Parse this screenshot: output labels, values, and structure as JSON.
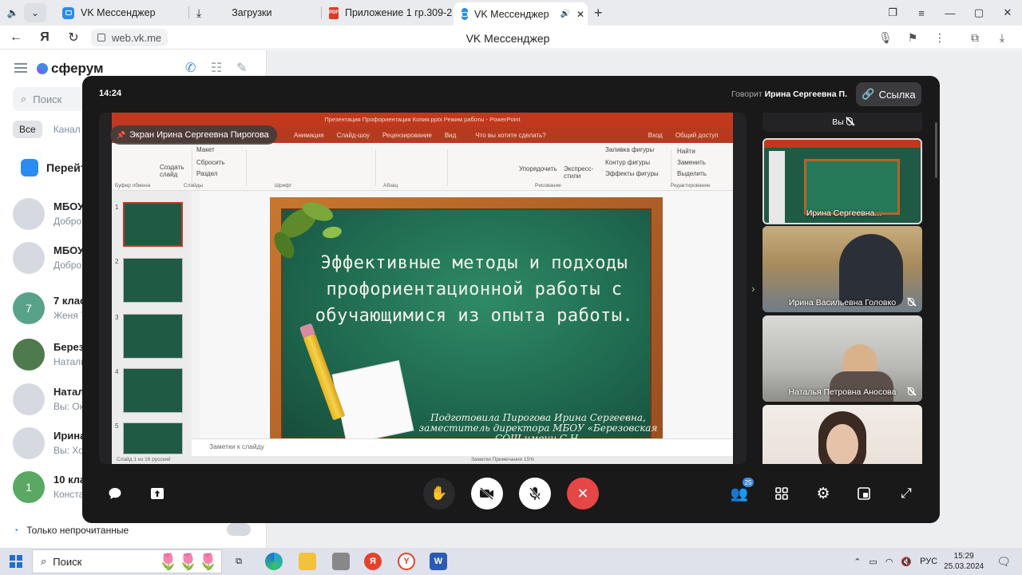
{
  "browser": {
    "tabs": [
      {
        "label": "VK Мессенджер",
        "icon": "vk-icon",
        "active": false
      },
      {
        "label": "Загрузки",
        "icon": "download-icon",
        "active": false
      },
      {
        "label": "Приложение 1 гр.309-24",
        "icon": "pdf-icon",
        "active": false
      },
      {
        "label": "VK Мессенджер",
        "icon": "vk-icon",
        "active": true
      }
    ],
    "url": "web.vk.me",
    "page_title": "VK Мессенджер"
  },
  "vk": {
    "logo": "сферум",
    "search_placeholder": "Поиск",
    "filters": [
      "Все",
      "Канал"
    ],
    "goto_label": "Перейт",
    "chats": [
      {
        "name": "МБОУ",
        "sub": "Добро",
        "badge": ""
      },
      {
        "name": "МБОУ",
        "sub": "Добро",
        "badge": ""
      },
      {
        "name": "7 клас",
        "sub": "Женя Т",
        "badge": "7"
      },
      {
        "name": "Березо",
        "sub": "Наталь",
        "badge": ""
      },
      {
        "name": "Натал",
        "sub": "Вы: Ок",
        "badge": ""
      },
      {
        "name": "Ирина",
        "sub": "Вы: Хо",
        "badge": ""
      },
      {
        "name": "10 кла",
        "sub": "Конста",
        "badge": "1"
      }
    ],
    "unread_only": "Только непрочитанные"
  },
  "call": {
    "time": "14:24",
    "speaking_prefix": "Говорит",
    "speaking_name": "Ирина Сергеевна П.",
    "link_label": "Ссылка",
    "screen_label": "Экран Ирина Сергеевна Пирогова",
    "participants_count": "25",
    "tiles": [
      {
        "name": "Вы"
      },
      {
        "name": "Ирина Сергеевна..."
      },
      {
        "name": "Ирина Васильевна Головко"
      },
      {
        "name": "Наталья Петровна Аносова"
      },
      {
        "name": ""
      }
    ]
  },
  "ppt": {
    "window_title": "Презентация Профориентация Копия.pptx  Режим работы - PowerPoint",
    "tabs": [
      "Файл",
      "Главная",
      "Вставка",
      "Дизайн",
      "Переходы",
      "Анимация",
      "Слайд-шоу",
      "Рецензирование",
      "Вид",
      "Что вы хотите сделать?",
      "Вход",
      "Общий доступ"
    ],
    "ribbon_items": [
      "Макет",
      "Сбросить",
      "Раздел",
      "Создать слайд",
      "Найти",
      "Заменить",
      "Выделить",
      "Упорядочить",
      "Экспресс-стили",
      "Заливка фигуры",
      "Контур фигуры",
      "Эффекты фигуры"
    ],
    "groups": [
      "Буфер обмена",
      "Слайды",
      "Шрифт",
      "Абзац",
      "Рисование",
      "Редактирование"
    ],
    "thumb_numbers": [
      "1",
      "2",
      "3",
      "4",
      "5"
    ],
    "notes_placeholder": "Заметки к слайду",
    "status": "Слайд 1 из 16    русский",
    "status_right": "Заметки    Примечания    15%"
  },
  "slide": {
    "title": "Эффективные методы и подходы профориентационной работы с обучающимися из опыта работы.",
    "author": "Подготовила Пирогова Ирина Сергеевна, заместитель директора МБОУ «Березовская СОШ имени С.Н."
  },
  "taskbar": {
    "search_placeholder": "Поиск",
    "lang": "РУС",
    "time": "15:29",
    "date": "25.03.2024"
  },
  "colors": {
    "call_bg": "#19191a",
    "hangup": "#e64646",
    "vk_blue": "#2a8cf0",
    "ppt_red": "#c0391e",
    "board_green": "#1f6a50"
  }
}
